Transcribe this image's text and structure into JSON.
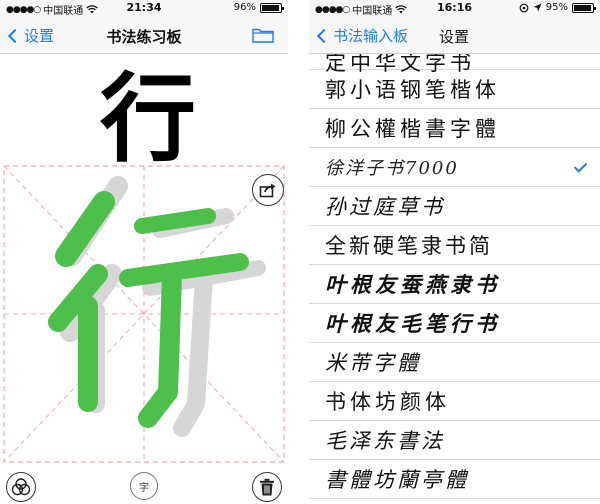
{
  "left": {
    "status": {
      "carrier": "中国联通",
      "time": "21:34",
      "battery": "96%",
      "battery_level": 0.96
    },
    "nav": {
      "back_label": "设置",
      "title": "书法练习板",
      "folder_icon": "folder-icon"
    },
    "model_character": "行",
    "practice_character": "行",
    "share_icon": "share-icon",
    "bottom": {
      "layers_icon": "layers-icon",
      "zi_label": "字",
      "trash_icon": "trash-icon"
    },
    "colors": {
      "accent": "#1b7cf3",
      "ink": "#000000",
      "brush": "#4cc04a",
      "ghost": "#d6d6d6",
      "guide": "#f2aaaa"
    }
  },
  "right": {
    "status": {
      "carrier": "中国联通",
      "time": "16:16",
      "battery": "95%",
      "battery_level": 0.95
    },
    "nav": {
      "back_label": "书法输入板",
      "title": "设置"
    },
    "fonts": [
      {
        "label": "定中华文字书",
        "style": "f-kai",
        "partial": true,
        "selected": false
      },
      {
        "label": "郭小语钢笔楷体",
        "style": "f-kai",
        "partial": false,
        "selected": false
      },
      {
        "label": "柳公權楷書字體",
        "style": "f-kai",
        "partial": false,
        "selected": false
      },
      {
        "label": "徐洋子书7000",
        "style": "f-thin",
        "partial": false,
        "selected": true
      },
      {
        "label": "孙过庭草书",
        "style": "f-script",
        "partial": false,
        "selected": false
      },
      {
        "label": "全新硬笔隶书简",
        "style": "f-sans",
        "partial": false,
        "selected": false
      },
      {
        "label": "叶根友蚕燕隶书",
        "style": "f-bold",
        "partial": false,
        "selected": false
      },
      {
        "label": "叶根友毛笔行书",
        "style": "f-bold",
        "partial": false,
        "selected": false
      },
      {
        "label": "米芾字體",
        "style": "f-script",
        "partial": false,
        "selected": false
      },
      {
        "label": "书体坊颜体",
        "style": "f-kai",
        "partial": false,
        "selected": false
      },
      {
        "label": "毛泽东書法",
        "style": "f-script",
        "partial": false,
        "selected": false
      },
      {
        "label": "書體坊蘭亭體",
        "style": "f-script",
        "partial": false,
        "selected": false
      }
    ]
  }
}
